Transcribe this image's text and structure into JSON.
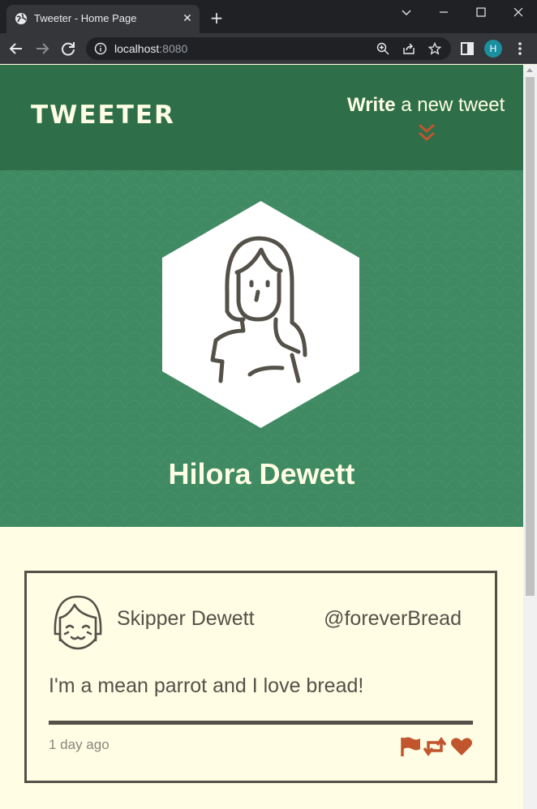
{
  "browser": {
    "tab_title": "Tweeter - Home Page",
    "url_host": "localhost",
    "url_port": ":8080",
    "profile_initial": "H",
    "icons": [
      "globe-icon",
      "close-icon",
      "plus-icon",
      "chevron-down-icon",
      "minimize-icon",
      "maximize-icon",
      "window-close-icon",
      "back-icon",
      "forward-icon",
      "reload-icon",
      "info-icon",
      "zoom-icon",
      "share-icon",
      "star-icon",
      "sidebar-icon",
      "kebab-menu-icon"
    ]
  },
  "header": {
    "logo": "TWEETER",
    "write_bold": "Write",
    "write_rest": " a new tweet"
  },
  "profile": {
    "name": "Hilora Dewett"
  },
  "tweet": {
    "author": "Skipper Dewett",
    "handle": "@foreverBread",
    "text": "I'm a mean parrot and I love bread!",
    "time": "1 day ago"
  },
  "colors": {
    "header_green": "#2e6f49",
    "banner_green": "#3f8a62",
    "cream": "#fffde4",
    "accent": "#c0552e",
    "ink": "#545149"
  }
}
